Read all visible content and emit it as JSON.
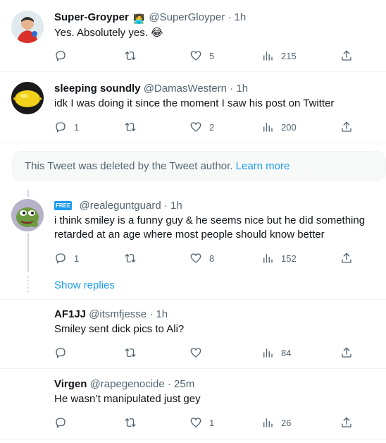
{
  "tweets": [
    {
      "name": "Super-Groyper",
      "handle": "@SuperGloyper",
      "time": "· 1h",
      "text": "Yes. Absolutely yes.",
      "emoji": "😂",
      "name_badge": "🧑‍💻",
      "counts": {
        "replies": "",
        "retweets": "",
        "likes": "5",
        "views": "215"
      }
    },
    {
      "name": "sleeping soundly",
      "handle": "@DamasWestern",
      "time": "· 1h",
      "text": "idk I was doing it since the moment I saw his post on Twitter",
      "counts": {
        "replies": "1",
        "retweets": "",
        "likes": "2",
        "views": "200"
      }
    },
    {
      "name": "",
      "badge": "FREE",
      "handle": "@realeguntguard",
      "time": "· 1h",
      "text": "i think smiley is a funny guy & he seems nice but he did something retarded at an age where most people should know better",
      "counts": {
        "replies": "1",
        "retweets": "",
        "likes": "8",
        "views": "152"
      }
    },
    {
      "name": "AF1JJ",
      "handle": "@itsmfjesse",
      "time": "· 1h",
      "text": "Smiley sent dick pics to Ali?",
      "counts": {
        "replies": "",
        "retweets": "",
        "likes": "",
        "views": "84"
      }
    },
    {
      "name": "Virgen",
      "handle": "@rapegenocide",
      "time": "· 25m",
      "text": "He wasn’t manipulated just gey",
      "counts": {
        "replies": "",
        "retweets": "",
        "likes": "1",
        "views": "26"
      }
    }
  ],
  "deleted_notice": {
    "text": "This Tweet was deleted by the Tweet author.",
    "link": "Learn more"
  },
  "show_replies": "Show replies",
  "colors": {
    "link": "#1d9bf0",
    "muted": "#536471",
    "text": "#0f1419",
    "divider": "#eff3f4"
  },
  "icons": [
    "reply-icon",
    "retweet-icon",
    "like-icon",
    "views-icon",
    "share-icon"
  ]
}
